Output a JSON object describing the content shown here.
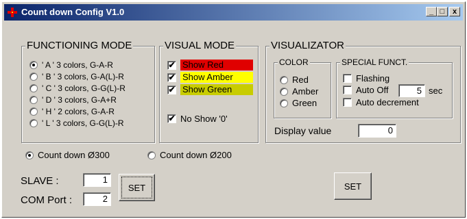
{
  "window": {
    "title": "Count down Config V1.0",
    "icon": "red-cross-icon",
    "buttons": {
      "minimize": "_",
      "maximize": "□",
      "close": "x"
    }
  },
  "functioning_mode": {
    "title": "FUNCTIONING MODE",
    "selected": 0,
    "options": [
      "' A ' 3 colors, G-A-R",
      "' B ' 3 colors, G-A(L)-R",
      "' C ' 3 colors, G-G(L)-R",
      "' D ' 3 colors, G-A+R",
      "' H ' 2 colors, G-A-R",
      "' L ' 3 colors, G-G(L)-R"
    ]
  },
  "visual_mode": {
    "title": "VISUAL MODE",
    "items": [
      {
        "label": "Show Red",
        "checked": true,
        "color": "#e00000"
      },
      {
        "label": "Show Amber",
        "checked": true,
        "color": "#ffff00"
      },
      {
        "label": "Show Green",
        "checked": true,
        "color": "#c8cc00"
      }
    ],
    "no_show": {
      "label": "No Show '0'",
      "checked": true
    }
  },
  "visualizator": {
    "title": "VISUALIZATOR",
    "color_group": {
      "title": "COLOR",
      "options": [
        "Red",
        "Amber",
        "Green"
      ],
      "selected": null
    },
    "special_group": {
      "title": "SPECIAL FUNCT.",
      "flashing": "Flashing",
      "auto_off": "Auto Off",
      "auto_off_value": "5",
      "auto_off_unit": "sec",
      "auto_decrement": "Auto decrement"
    },
    "display_label": "Display value",
    "display_value": "0"
  },
  "countdown": {
    "options": [
      "Count down Ø300",
      "Count down Ø200"
    ],
    "selected": 0
  },
  "slave": {
    "label": "SLAVE :",
    "value": "1"
  },
  "com_port": {
    "label": "COM Port :",
    "value": "2"
  },
  "set_left": "SET",
  "set_right": "SET",
  "check_mark": "✔"
}
